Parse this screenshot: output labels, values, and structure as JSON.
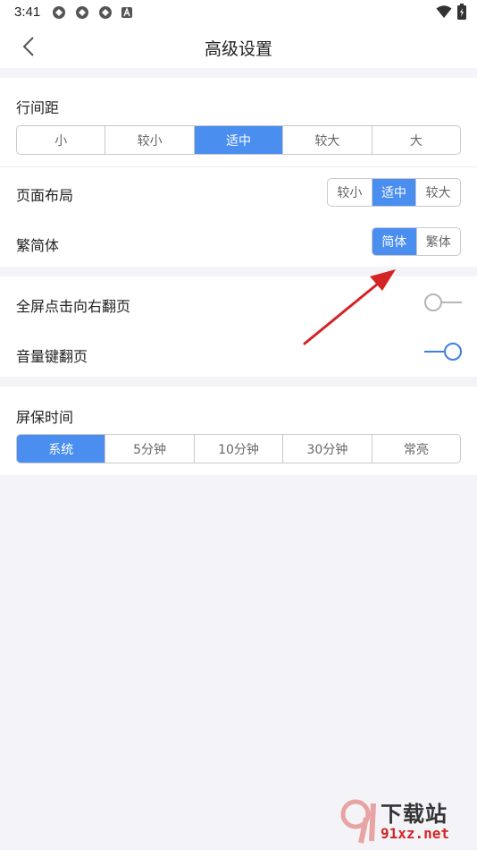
{
  "status_bar": {
    "time": "3:41",
    "icons": [
      "app-notification-icon",
      "app-notification-icon",
      "app-notification-icon",
      "a-icon"
    ],
    "right_icons": [
      "wifi-icon",
      "battery-icon"
    ]
  },
  "header": {
    "title": "高级设置"
  },
  "line_spacing": {
    "label": "行间距",
    "options": [
      "小",
      "较小",
      "适中",
      "较大",
      "大"
    ],
    "selected": "适中"
  },
  "page_layout": {
    "label": "页面布局",
    "options": [
      "较小",
      "适中",
      "较大"
    ],
    "selected": "适中"
  },
  "script": {
    "label": "繁简体",
    "options": [
      "简体",
      "繁体"
    ],
    "selected": "简体"
  },
  "fullscreen_tap": {
    "label": "全屏点击向右翻页",
    "enabled": false
  },
  "volume_key": {
    "label": "音量键翻页",
    "enabled": true
  },
  "screensaver": {
    "label": "屏保时间",
    "options": [
      "系统",
      "5分钟",
      "10分钟",
      "30分钟",
      "常亮"
    ],
    "selected": "系统"
  },
  "watermark": {
    "brand": "下载站",
    "url": "91xz.net"
  },
  "colors": {
    "accent": "#4a8ef0",
    "background": "#f4f4f8",
    "annotation_arrow": "#d32525"
  }
}
